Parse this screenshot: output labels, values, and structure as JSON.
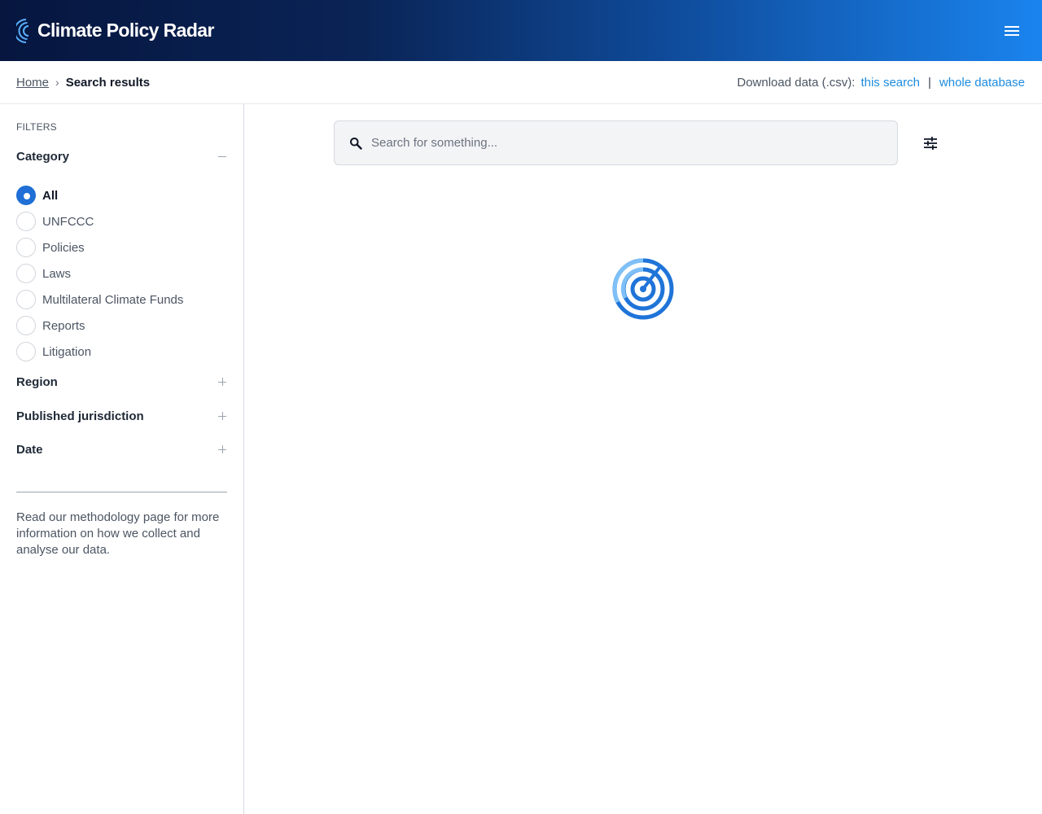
{
  "header": {
    "logo_text": "Climate Policy Radar",
    "menu_icon": "hamburger-menu-icon"
  },
  "breadcrumb": {
    "home": "Home",
    "separator": "›",
    "current": "Search results"
  },
  "download": {
    "label": "Download data (.csv):",
    "this_search": "this search",
    "separator": "|",
    "whole_database": "whole database"
  },
  "filters": {
    "title": "FILTERS",
    "category": {
      "label": "Category",
      "expanded": true,
      "options": [
        {
          "label": "All",
          "selected": true
        },
        {
          "label": "UNFCCC",
          "selected": false
        },
        {
          "label": "Policies",
          "selected": false
        },
        {
          "label": "Laws",
          "selected": false
        },
        {
          "label": "Multilateral Climate Funds",
          "selected": false
        },
        {
          "label": "Reports",
          "selected": false
        },
        {
          "label": "Litigation",
          "selected": false
        }
      ]
    },
    "region": {
      "label": "Region",
      "expanded": false
    },
    "jurisdiction": {
      "label": "Published jurisdiction",
      "expanded": false
    },
    "date": {
      "label": "Date",
      "expanded": false
    }
  },
  "methodology_note": "Read our methodology page for more information on how we collect and analyse our data.",
  "search": {
    "placeholder": "Search for something...",
    "value": "",
    "icon": "search-icon"
  },
  "filter_button_icon": "sliders-icon",
  "loading_icon": "radar-loading-icon",
  "colors": {
    "header_dark": "#06163f",
    "header_light": "#1a84ee",
    "link": "#1d8ce0",
    "radio_selected": "#1f6fd6"
  }
}
